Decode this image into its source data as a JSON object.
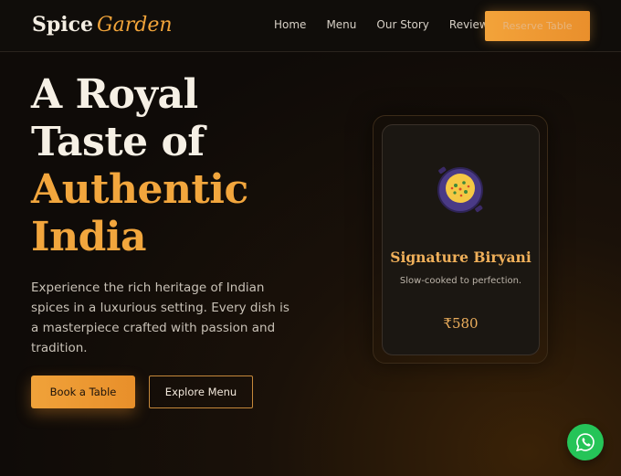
{
  "brand": {
    "name": "Spice",
    "accent": "Garden"
  },
  "nav": {
    "links": [
      "Home",
      "Menu",
      "Our Story",
      "Reviews"
    ],
    "cta": "Reserve Table"
  },
  "hero": {
    "title_line1": "A Royal",
    "title_line2": "Taste of",
    "title_line3": "Authentic",
    "title_line4": "India",
    "description": "Experience the rich heritage of Indian spices in a luxurious setting. Every dish is a masterpiece crafted with passion and tradition.",
    "primary_button": "Book a Table",
    "secondary_button": "Explore Menu"
  },
  "card": {
    "icon": "biryani-pot-icon",
    "title": "Signature Biryani",
    "subtitle": "Slow-cooked to perfection.",
    "price": "₹580"
  },
  "floating": {
    "icon": "whatsapp-icon"
  },
  "colors": {
    "accent": "#f2a63d",
    "background": "#0f0b08",
    "whatsapp": "#25c458"
  }
}
